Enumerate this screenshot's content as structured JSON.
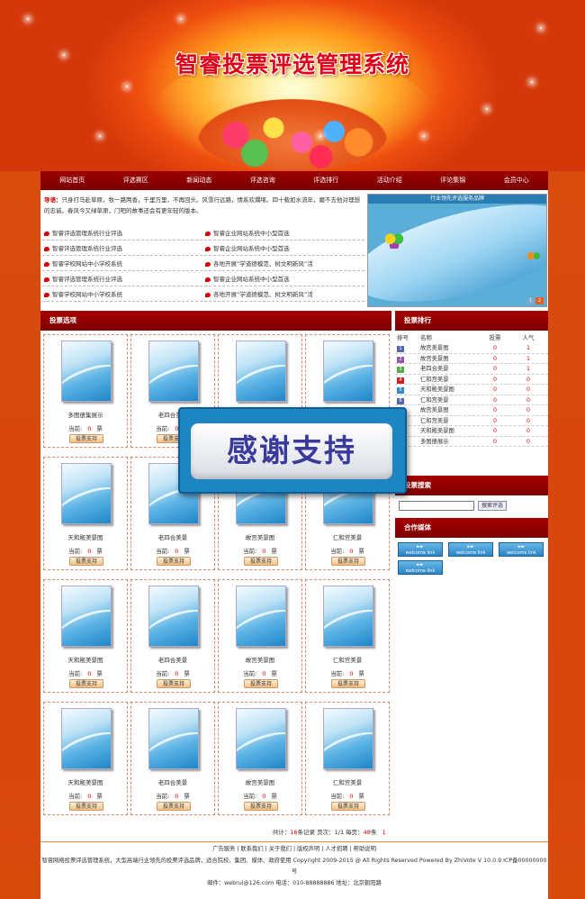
{
  "banner": {
    "title": "智睿投票评选管理系统"
  },
  "nav": [
    "网站首页",
    "评选赛区",
    "新闻动态",
    "评选咨询",
    "评选排行",
    "活动介绍",
    "评论集锦",
    "会员中心"
  ],
  "notice": {
    "label": "导语：",
    "text": "只身打马赴草原，牧一路两香，千里万里，不再回头。风雪行远路，情系欢爛塚。四十载如水流年，磨不去他对理想的忠诚。春风今又绿草原，门吧的故事还会有更年轻的版本。"
  },
  "news": [
    [
      "智睿评选管理系统行业评选",
      "智睿企业网站系统中小型首选"
    ],
    [
      "智睿评选管理系统行业评选",
      "智睿企业网站系统中小型首选"
    ],
    [
      "智睿学校网站中小学校系统",
      "各地开展“学道德模范、树文明新风”活"
    ],
    [
      "智睿评选管理系统行业评选",
      "智睿企业网站系统中小型首选"
    ],
    [
      "智睿学校网站中小学校系统",
      "各地开展“学道德模范、树文明新风”活"
    ]
  ],
  "promo": {
    "caption": "行业领先评选服务品牌",
    "pages": [
      "1",
      "2"
    ]
  },
  "sections": {
    "vote": "投票选项",
    "rank": "投票排行",
    "search": "投票搜索",
    "media": "合作媒体"
  },
  "cards": [
    {
      "name": "多图册集展示",
      "votes": "0"
    },
    {
      "name": "老四合美景",
      "votes": "0"
    },
    {
      "name": "故宫美景图",
      "votes": "0"
    },
    {
      "name": "仁和宫美景",
      "votes": "0"
    },
    {
      "name": "天和殿美景图",
      "votes": "0"
    },
    {
      "name": "老四合美景",
      "votes": "0"
    },
    {
      "name": "故宫美景图",
      "votes": "0"
    },
    {
      "name": "仁和宫美景",
      "votes": "0"
    },
    {
      "name": "天和殿美景图",
      "votes": "0"
    },
    {
      "name": "老四合美景",
      "votes": "0"
    },
    {
      "name": "故宫美景图",
      "votes": "0"
    },
    {
      "name": "仁和宫美景",
      "votes": "0"
    },
    {
      "name": "天和殿美景图",
      "votes": "0"
    },
    {
      "name": "老四合美景",
      "votes": "0"
    },
    {
      "name": "故宫美景图",
      "votes": "0"
    },
    {
      "name": "仁和宫美景",
      "votes": "0"
    }
  ],
  "card_labels": {
    "current": "当前:",
    "unit": "票",
    "button": "投票支持"
  },
  "rank": {
    "headers": [
      "排号",
      "名称",
      "投票",
      "人气"
    ],
    "rows": [
      {
        "no": "1",
        "name": "故宫美景图",
        "votes": "0",
        "hot": "1",
        "color": "#5566aa"
      },
      {
        "no": "2",
        "name": "故宫美景图",
        "votes": "0",
        "hot": "1",
        "color": "#9955aa"
      },
      {
        "no": "3",
        "name": "老四合美景",
        "votes": "0",
        "hot": "1",
        "color": "#55aa44"
      },
      {
        "no": "4",
        "name": "仁和宫美景",
        "votes": "0",
        "hot": "0",
        "color": "#cc2222"
      },
      {
        "no": "5",
        "name": "天和殿美景图",
        "votes": "0",
        "hot": "0",
        "color": "#3388cc"
      },
      {
        "no": "6",
        "name": "仁和宫美景",
        "votes": "0",
        "hot": "0",
        "color": "#5566aa"
      },
      {
        "no": "7",
        "name": "故宫美景图",
        "votes": "0",
        "hot": "0",
        "color": "#5566aa"
      },
      {
        "no": "8",
        "name": "仁和宫美景",
        "votes": "0",
        "hot": "0",
        "color": "#5566aa"
      },
      {
        "no": "9",
        "name": "天和殿美景图",
        "votes": "0",
        "hot": "0",
        "color": "#5566aa"
      },
      {
        "no": "10",
        "name": "多图册展示",
        "votes": "0",
        "hot": "0",
        "color": "#5566aa"
      }
    ]
  },
  "search": {
    "button": "搜索评选",
    "value": ""
  },
  "media": [
    "welcome link",
    "welcome link",
    "welcome link",
    "welcome link"
  ],
  "pager": {
    "text1": "共计：",
    "total": "16",
    "text2": "条记录 页次：",
    "page": "1/1",
    "text3": " 每页：",
    "per": "48",
    "text4": "条",
    "num": "1"
  },
  "footer": {
    "links": "广告服务 | 联系我们 | 关于我们 | 版权声明 | 人才招聘 | 帮助说明",
    "desc": "智睿网络投票评选管理系统，大型高端行业领先的投票评选品牌，适合院校、集团、媒体、政府使用  Copyright 2009-2015 @ All Rights Reserved Powered By ZhiVote V 10.0.9 ICP备00000000号",
    "contact": "邮件：webrui@126.com  电话：010-88888886      地址：北京朝阳路"
  },
  "overlay": {
    "text": "感谢支持"
  }
}
